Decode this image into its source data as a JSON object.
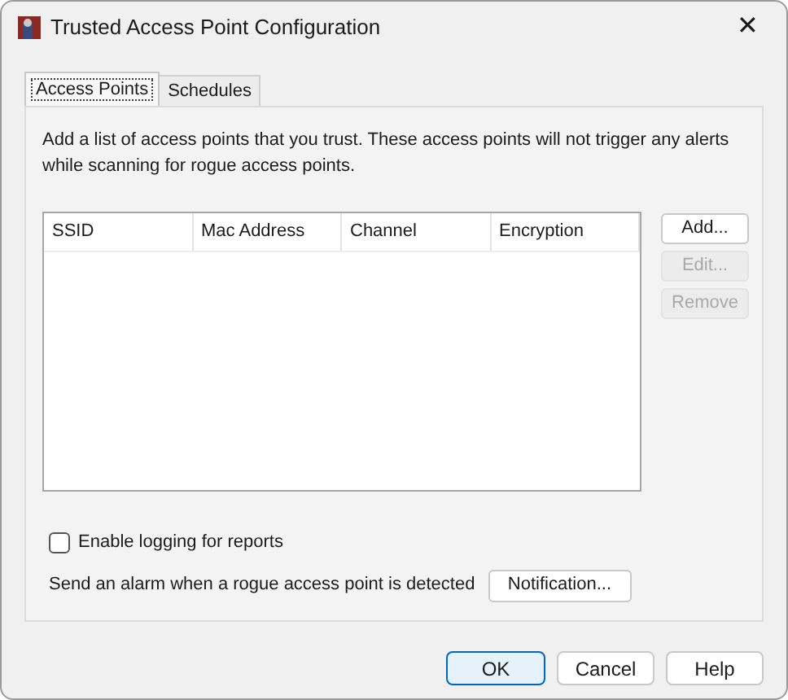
{
  "window": {
    "title": "Trusted Access Point Configuration",
    "close": "✕"
  },
  "tabs": [
    {
      "label": "Access Points",
      "selected": true
    },
    {
      "label": "Schedules",
      "selected": false
    }
  ],
  "description": "Add a list of access points that you trust. These access points will not trigger any alerts while scanning for rogue access points.",
  "table": {
    "columns": [
      "SSID",
      "Mac Address",
      "Channel",
      "Encryption"
    ]
  },
  "side_buttons": [
    {
      "label": "Add...",
      "disabled": false
    },
    {
      "label": "Edit...",
      "disabled": true
    },
    {
      "label": "Remove",
      "disabled": true
    }
  ],
  "logging": {
    "label": "Enable logging for reports",
    "checked": false
  },
  "alarm": {
    "label": "Send an alarm when a rogue access point is detected",
    "button": "Notification..."
  },
  "buttons": [
    {
      "label": "OK",
      "default": true
    },
    {
      "label": "Cancel",
      "default": false
    },
    {
      "label": "Help",
      "default": false
    }
  ]
}
